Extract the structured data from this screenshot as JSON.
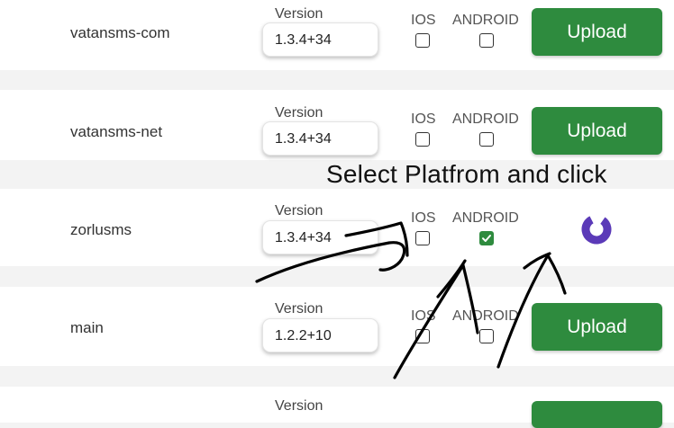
{
  "labels": {
    "version": "Version",
    "ios": "IOS",
    "android": "ANDROID",
    "upload": "Upload"
  },
  "rows": [
    {
      "app": "vatansms-com",
      "version": "1.3.4+34",
      "ios_checked": false,
      "android_checked": false,
      "state": "upload"
    },
    {
      "app": "vatansms-net",
      "version": "1.3.4+34",
      "ios_checked": false,
      "android_checked": false,
      "state": "upload"
    },
    {
      "app": "zorlusms",
      "version": "1.3.4+34",
      "ios_checked": false,
      "android_checked": true,
      "state": "loading"
    },
    {
      "app": "main",
      "version": "1.2.2+10",
      "ios_checked": false,
      "android_checked": false,
      "state": "upload"
    },
    {
      "app": "",
      "version": "",
      "state": "upload"
    }
  ],
  "annotation": {
    "text": "Select Platfrom  and click"
  },
  "colors": {
    "upload_green": "#2e8b3e",
    "spinner_purple": "#5b3ab8",
    "row_bg": "#ffffff",
    "page_bg": "#f3f3f3"
  },
  "icons": {
    "checkbox_checked": "check-icon",
    "loading": "spinner-icon"
  }
}
